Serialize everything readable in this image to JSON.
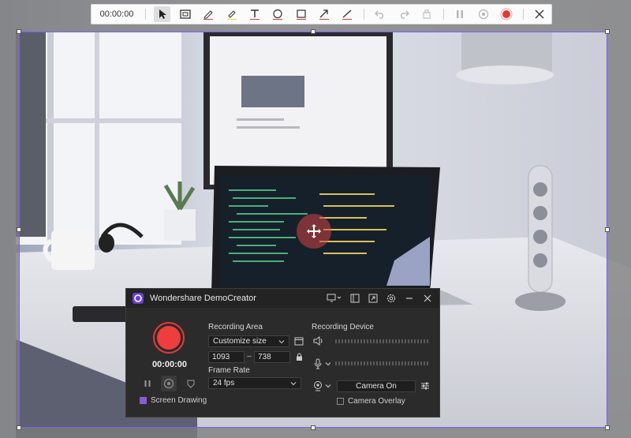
{
  "toolbar": {
    "timer": "00:00:00",
    "tools": [
      "cursor-icon",
      "screenshot-icon",
      "pen-icon",
      "highlighter-icon",
      "text-icon",
      "circle-icon",
      "rectangle-icon",
      "arrow-icon",
      "line-icon",
      "undo-icon",
      "redo-icon",
      "eraser-icon",
      "pause-icon",
      "stop-icon",
      "record-icon",
      "close-icon"
    ],
    "accent_color": "#e53935"
  },
  "recorder": {
    "app_title": "Wondershare DemoCreator",
    "timer": "00:00:00",
    "screen_drawing_label": "Screen Drawing",
    "screen_drawing_checked": true,
    "recording_area": {
      "title": "Recording Area",
      "mode": "Customize size",
      "width": "1093",
      "separator": "–",
      "height": "738"
    },
    "frame_rate": {
      "title": "Frame Rate",
      "value": "24 fps"
    },
    "recording_device": {
      "title": "Recording Device",
      "camera_button": "Camera On",
      "camera_overlay_label": "Camera Overlay",
      "camera_overlay_checked": false
    },
    "colors": {
      "record": "#ee3d3d",
      "accent": "#8a5cd6"
    }
  }
}
